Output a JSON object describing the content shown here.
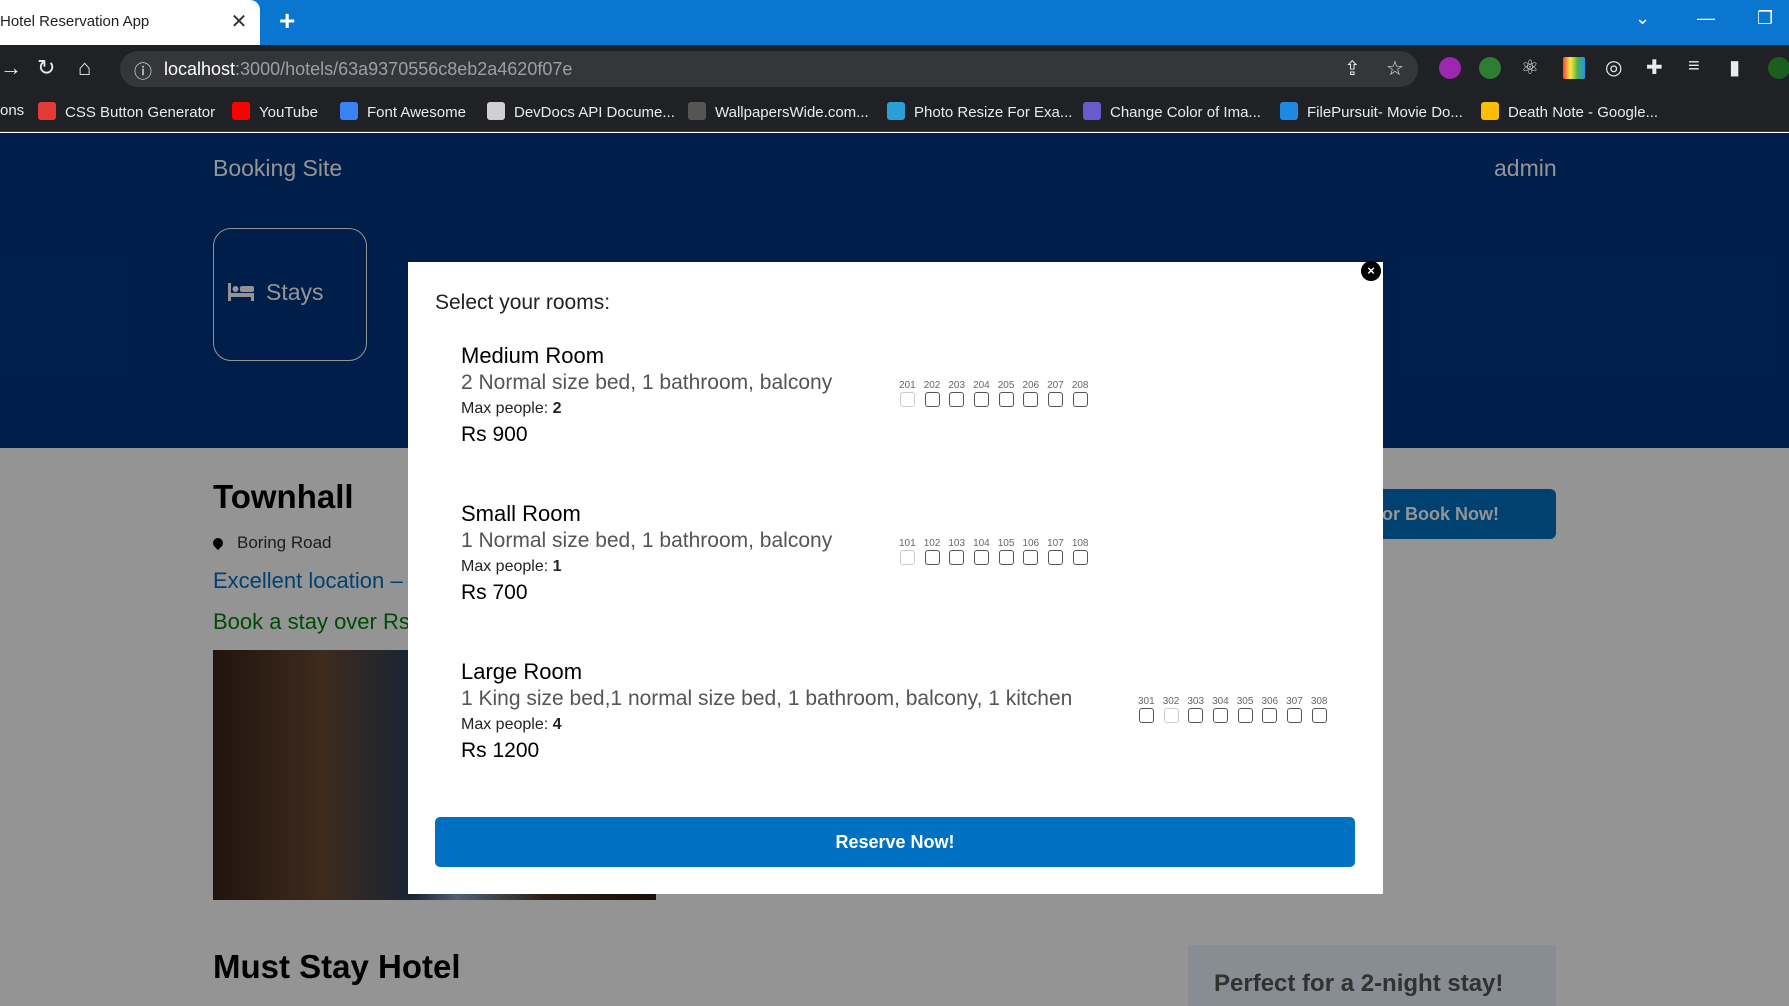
{
  "browser": {
    "tab_title": "Hotel Reservation App",
    "url_host": "localhost",
    "url_path": ":3000/hotels/63a9370556c8eb2a4620f07e",
    "bookmarks": [
      {
        "label": "ons",
        "color": "#202124"
      },
      {
        "label": "CSS Button Generator",
        "color": "#e53935"
      },
      {
        "label": "YouTube",
        "color": "#ff0000"
      },
      {
        "label": "Font Awesome",
        "color": "#3b82f6"
      },
      {
        "label": "DevDocs API Docume...",
        "color": "#d0d0d0"
      },
      {
        "label": "WallpapersWide.com...",
        "color": "#555555"
      },
      {
        "label": "Photo Resize For Exa...",
        "color": "#2a9fd6"
      },
      {
        "label": "Change Color of Ima...",
        "color": "#6a5acd"
      },
      {
        "label": "FilePursuit- Movie Do...",
        "color": "#1e88e5"
      },
      {
        "label": "Death Note - Google...",
        "color": "#fbbc04"
      }
    ]
  },
  "site": {
    "logo": "Booking Site",
    "user": "admin",
    "stays_label": "Stays"
  },
  "hotel": {
    "name": "Townhall",
    "address": "Boring Road",
    "distance": "Excellent location –",
    "highlight": "Book a stay over Rs",
    "book_button": "ve or Book Now!",
    "secondary_title": "Must Stay Hotel",
    "perfect_text": "Perfect for a 2-night stay!"
  },
  "modal": {
    "title": "Select your rooms:",
    "close_symbol": "×",
    "max_people_label": "Max people:",
    "reserve_button": "Reserve Now!",
    "rooms": [
      {
        "title": "Medium Room",
        "desc": "2 Normal size bed, 1 bathroom, balcony",
        "max_people": "2",
        "price": "Rs 900",
        "numbers": [
          "201",
          "202",
          "203",
          "204",
          "205",
          "206",
          "207",
          "208"
        ],
        "disabled": [
          "201"
        ]
      },
      {
        "title": "Small Room",
        "desc": "1 Normal size bed, 1 bathroom, balcony",
        "max_people": "1",
        "price": "Rs 700",
        "numbers": [
          "101",
          "102",
          "103",
          "104",
          "105",
          "106",
          "107",
          "108"
        ],
        "disabled": [
          "101"
        ]
      },
      {
        "title": "Large Room",
        "desc": "1 King size bed,1 normal size bed, 1 bathroom, balcony, 1 kitchen",
        "max_people": "4",
        "price": "Rs 1200",
        "numbers": [
          "301",
          "302",
          "303",
          "304",
          "305",
          "306",
          "307",
          "308"
        ],
        "disabled": [
          "302"
        ]
      }
    ]
  },
  "colors": {
    "chrome_tab_bar": "#0a76d0",
    "header": "#003580",
    "primary_button": "#0071c2",
    "green_text": "#008009"
  }
}
